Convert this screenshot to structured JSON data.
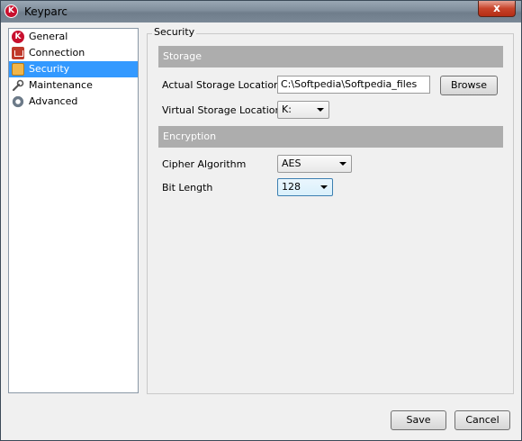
{
  "window": {
    "title": "Keyparc",
    "app_icon_letter": "K",
    "close_glyph": "x"
  },
  "sidebar": {
    "items": [
      {
        "label": "General",
        "icon": "keyparc-logo-icon",
        "selected": false
      },
      {
        "label": "Connection",
        "icon": "connection-icon",
        "selected": false
      },
      {
        "label": "Security",
        "icon": "security-icon",
        "selected": true
      },
      {
        "label": "Maintenance",
        "icon": "wrench-icon",
        "selected": false
      },
      {
        "label": "Advanced",
        "icon": "gear-icon",
        "selected": false
      }
    ]
  },
  "panel": {
    "label": "Security",
    "storage": {
      "header": "Storage",
      "actual_label": "Actual Storage Location",
      "actual_value": "C:\\Softpedia\\Softpedia_files",
      "browse_label": "Browse",
      "virtual_label": "Virtual Storage Location",
      "virtual_value": "K:"
    },
    "encryption": {
      "header": "Encryption",
      "cipher_label": "Cipher Algorithm",
      "cipher_value": "AES",
      "bits_label": "Bit Length",
      "bits_value": "128"
    }
  },
  "footer": {
    "save_label": "Save",
    "cancel_label": "Cancel"
  },
  "colors": {
    "selection": "#3399ff",
    "section_header": "#adadad",
    "close_button": "#c7432a"
  }
}
